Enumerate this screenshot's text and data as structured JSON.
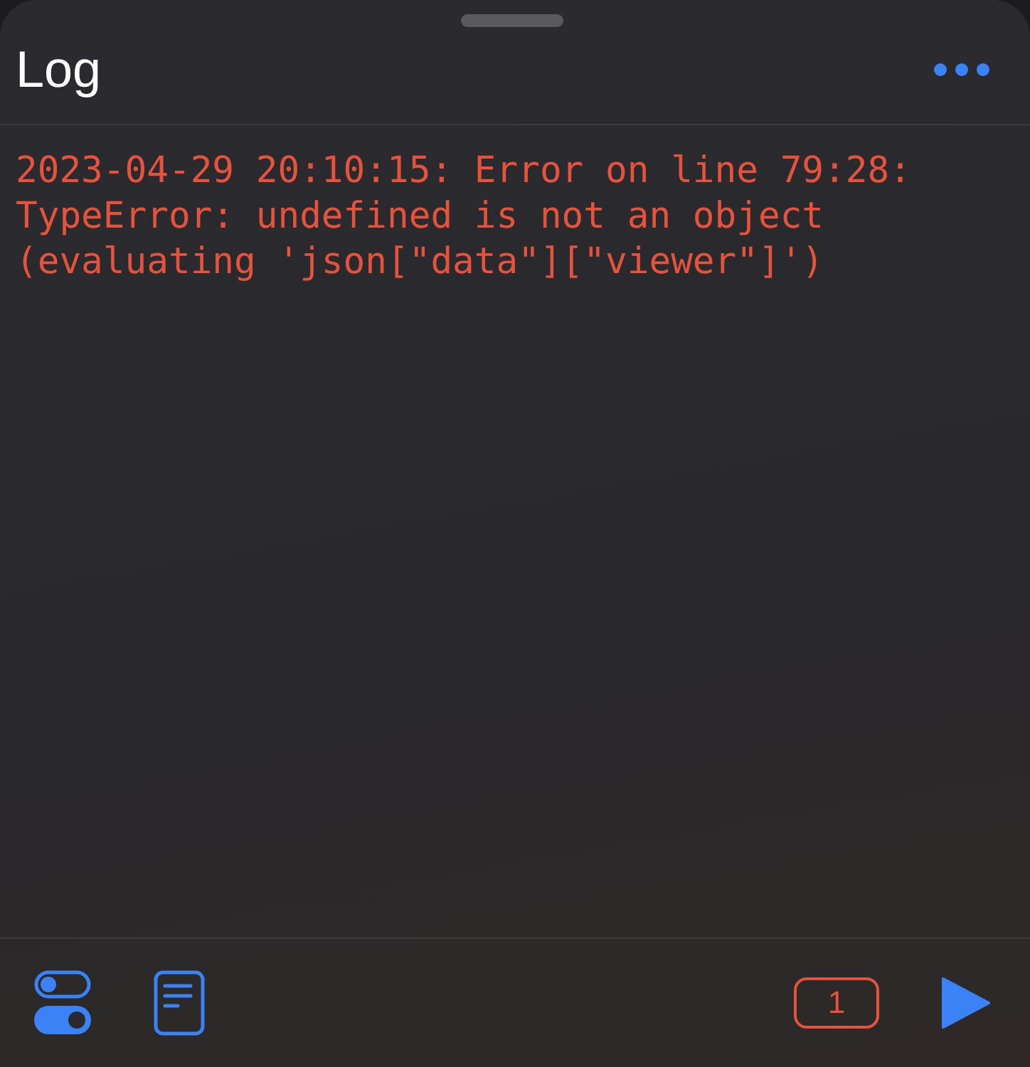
{
  "title": "Log",
  "log_lines": [
    "2023-04-29 20:10:15: Error on line 79:28:",
    "TypeError: undefined is not an object",
    "(evaluating 'json[\"data\"][\"viewer\"]')"
  ],
  "error_count": "1"
}
